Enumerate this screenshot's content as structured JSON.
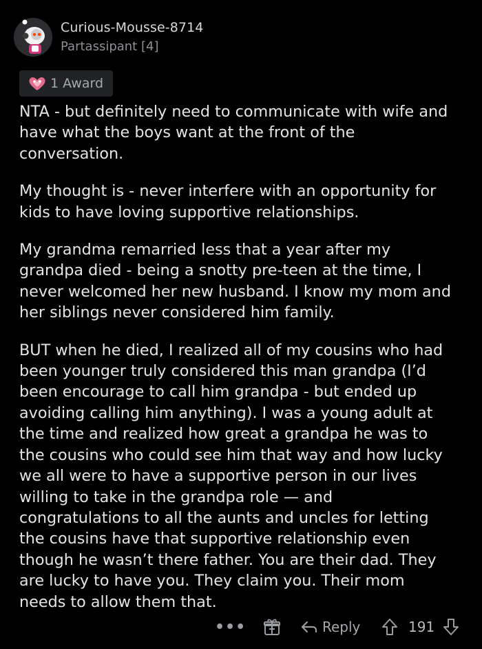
{
  "comment": {
    "author": "Curious-Mousse-8714",
    "flair": "Partassipant [4]",
    "award": {
      "label": "1 Award",
      "icon": "heart-award-icon"
    },
    "paragraphs": [
      "NTA - but definitely need to communicate with wife and\nhave what the boys want at the front of the\nconversation.",
      "My thought is - never interfere with an opportunity for\nkids to have loving supportive relationships.",
      "My grandma remarried less that a year after my\ngrandpa died - being a snotty pre-teen at the time, I\nnever welcomed her new husband. I know my mom and\nher siblings never considered him family.",
      "BUT when he died, I realized all of my cousins who had\nbeen younger truly considered this man grandpa (I’d\nbeen encourage to call him grandpa - but ended up\navoiding calling him anything). I was a young adult at\nthe time and realized how great a grandpa he was to\nthe cousins who could see him that way and how lucky\nwe all were to have a supportive person in our lives\nwilling to take in the grandpa role — and\ncongratulations to all the aunts and uncles for letting\nthe cousins have that supportive relationship even\nthough he wasn’t there father. You are their dad. They\nare lucky to have you. They claim you. Their mom\nneeds to allow them that."
    ],
    "actions": {
      "more_label": "•••",
      "reply_label": "Reply",
      "score": "191"
    }
  },
  "colors": {
    "background": "#000000",
    "text": "#e3e4e6",
    "muted": "#8d9196",
    "chip": "#222327",
    "award_pink": "#e56b8a"
  }
}
